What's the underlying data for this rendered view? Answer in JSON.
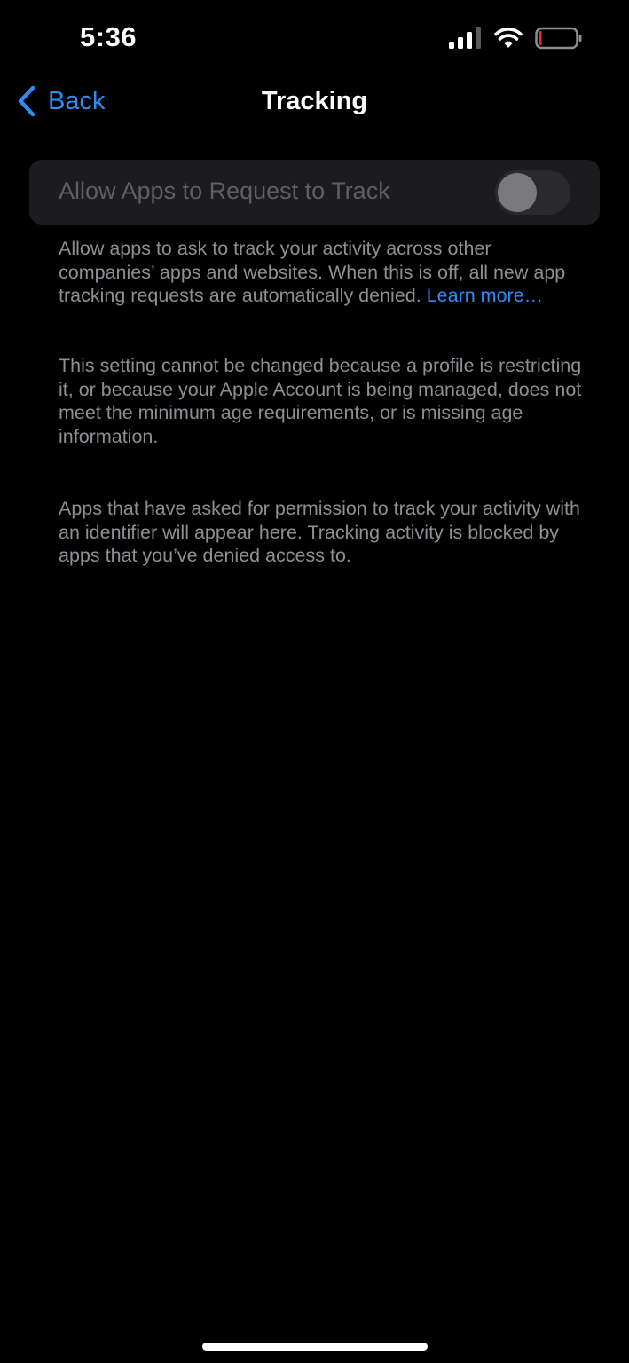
{
  "status_bar": {
    "time": "5:36",
    "icons": [
      "cellular-signal-icon",
      "wifi-icon",
      "battery-low-icon"
    ],
    "battery_level": 0.05,
    "battery_color": "#e0322a"
  },
  "nav": {
    "back_label": "Back",
    "title": "Tracking"
  },
  "toggle": {
    "label": "Allow Apps to Request to Track",
    "state": "off",
    "disabled": true
  },
  "footer": {
    "description": "Allow apps to ask to track your activity across other companies’ apps and websites. When this is off, all new app tracking requests are automatically denied.",
    "learn_more": "Learn more…",
    "restriction_note": "This setting cannot be changed because a profile is restricting it, or because your Apple Account is being managed, does not meet the minimum age requirements, or is missing age information.",
    "apps_note": "Apps that have asked for permission to track your activity with an identifier will appear here. Tracking activity is blocked by apps that you’ve denied access to."
  },
  "colors": {
    "background": "#000000",
    "accent": "#2f8cf5",
    "card": "#1c1c1e",
    "secondary_text": "#8e8e93"
  }
}
